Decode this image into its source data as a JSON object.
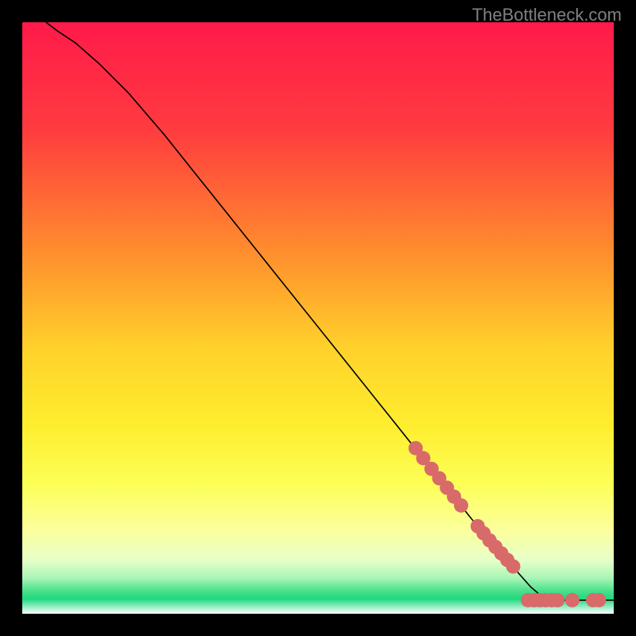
{
  "watermark": "TheBottleneck.com",
  "chart_data": {
    "type": "line",
    "title": "",
    "xlabel": "",
    "ylabel": "",
    "xlim": [
      0,
      100
    ],
    "ylim": [
      0,
      100
    ],
    "gradient_stops": [
      {
        "offset": 0,
        "color": "#ff1a4a"
      },
      {
        "offset": 18,
        "color": "#ff3b3f"
      },
      {
        "offset": 38,
        "color": "#ff8a2e"
      },
      {
        "offset": 55,
        "color": "#ffd12b"
      },
      {
        "offset": 68,
        "color": "#feed2e"
      },
      {
        "offset": 78,
        "color": "#fcff56"
      },
      {
        "offset": 86,
        "color": "#fbff9e"
      },
      {
        "offset": 91,
        "color": "#e6ffc8"
      },
      {
        "offset": 94,
        "color": "#a8f5b7"
      },
      {
        "offset": 96,
        "color": "#4fe28e"
      },
      {
        "offset": 97.5,
        "color": "#1ed97f"
      },
      {
        "offset": 100,
        "color": "#ffffff"
      }
    ],
    "curve": [
      {
        "x": 4,
        "y": 100
      },
      {
        "x": 6,
        "y": 98.5
      },
      {
        "x": 9,
        "y": 96.5
      },
      {
        "x": 13,
        "y": 93
      },
      {
        "x": 18,
        "y": 88
      },
      {
        "x": 24,
        "y": 81
      },
      {
        "x": 30,
        "y": 73.5
      },
      {
        "x": 38,
        "y": 63.5
      },
      {
        "x": 46,
        "y": 53.5
      },
      {
        "x": 54,
        "y": 43.5
      },
      {
        "x": 62,
        "y": 33.5
      },
      {
        "x": 70,
        "y": 23.5
      },
      {
        "x": 76,
        "y": 16
      },
      {
        "x": 82,
        "y": 9
      },
      {
        "x": 86,
        "y": 4.5
      },
      {
        "x": 88,
        "y": 2.8
      },
      {
        "x": 90,
        "y": 2.3
      },
      {
        "x": 94,
        "y": 2.3
      },
      {
        "x": 100,
        "y": 2.3
      }
    ],
    "markers": [
      {
        "x": 66.5,
        "y": 28.0
      },
      {
        "x": 67.8,
        "y": 26.3
      },
      {
        "x": 69.2,
        "y": 24.5
      },
      {
        "x": 70.5,
        "y": 22.9
      },
      {
        "x": 71.8,
        "y": 21.3
      },
      {
        "x": 73.0,
        "y": 19.8
      },
      {
        "x": 74.2,
        "y": 18.3
      },
      {
        "x": 77.0,
        "y": 14.8
      },
      {
        "x": 78.0,
        "y": 13.6
      },
      {
        "x": 79.0,
        "y": 12.4
      },
      {
        "x": 80.0,
        "y": 11.3
      },
      {
        "x": 81.0,
        "y": 10.2
      },
      {
        "x": 82.0,
        "y": 9.1
      },
      {
        "x": 83.0,
        "y": 8.0
      },
      {
        "x": 85.5,
        "y": 2.3
      },
      {
        "x": 86.5,
        "y": 2.3
      },
      {
        "x": 87.5,
        "y": 2.3
      },
      {
        "x": 88.5,
        "y": 2.3
      },
      {
        "x": 89.5,
        "y": 2.3
      },
      {
        "x": 90.5,
        "y": 2.3
      },
      {
        "x": 93.0,
        "y": 2.3
      },
      {
        "x": 96.5,
        "y": 2.3
      },
      {
        "x": 97.5,
        "y": 2.3
      }
    ],
    "marker_color": "#d86a6a",
    "marker_radius_px": 9
  }
}
